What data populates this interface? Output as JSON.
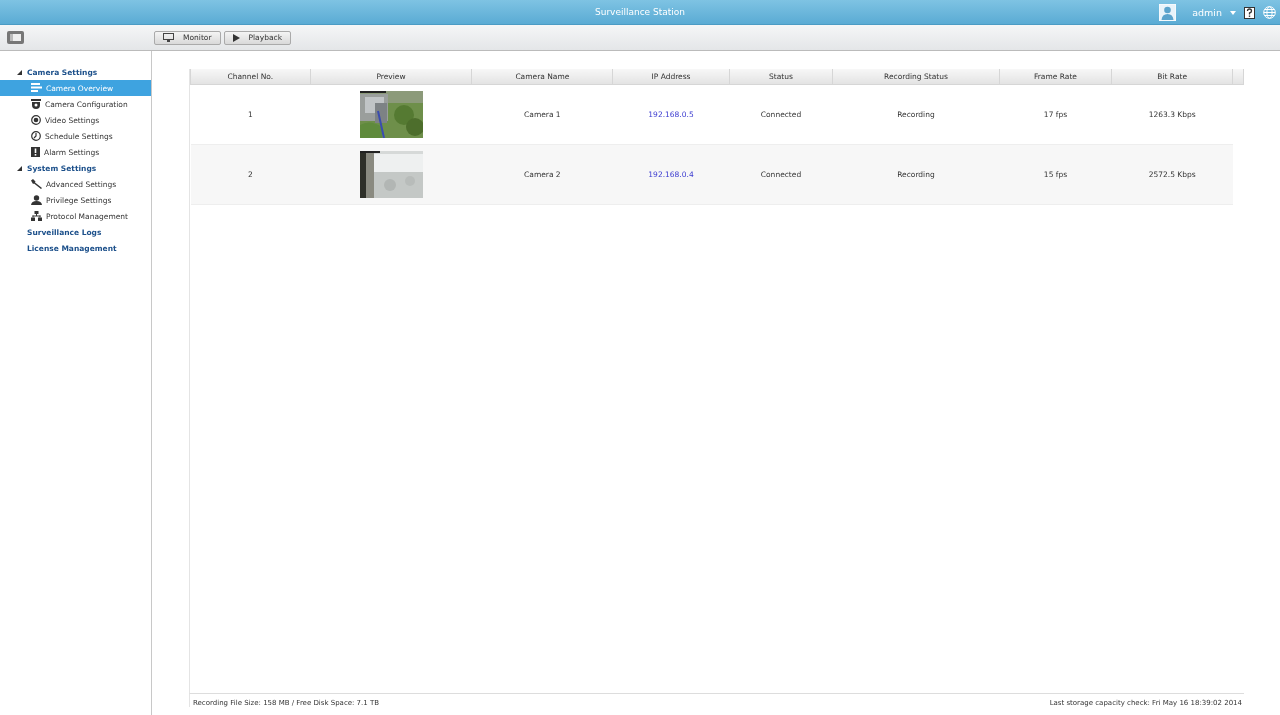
{
  "window": {
    "title": "Surveillance Station"
  },
  "user": {
    "name": "admin"
  },
  "toolbar": {
    "buttons": [
      {
        "label": "Monitor"
      },
      {
        "label": "Playback"
      }
    ]
  },
  "sidebar": {
    "items": [
      {
        "label": "Camera Settings",
        "expanded": true,
        "children": [
          {
            "label": "Camera Overview",
            "selected": true
          },
          {
            "label": "Camera Configuration",
            "selected": false
          },
          {
            "label": "Video Settings",
            "selected": false
          },
          {
            "label": "Schedule Settings",
            "selected": false
          },
          {
            "label": "Alarm Settings",
            "selected": false
          }
        ]
      },
      {
        "label": "System Settings",
        "expanded": true,
        "children": [
          {
            "label": "Advanced Settings",
            "selected": false
          },
          {
            "label": "Privilege Settings",
            "selected": false
          },
          {
            "label": "Protocol Management",
            "selected": false
          }
        ]
      },
      {
        "label": "Surveillance Logs"
      },
      {
        "label": "License Management"
      }
    ]
  },
  "table": {
    "columns": [
      "Channel No.",
      "Preview",
      "Camera Name",
      "IP Address",
      "Status",
      "Recording Status",
      "Frame Rate",
      "Bit Rate"
    ],
    "rows": [
      {
        "channel": "1",
        "name": "Camera 1",
        "ip": "192.168.0.5",
        "status": "Connected",
        "recording": "Recording",
        "frame_rate": "17 fps",
        "bit_rate": "1263.3 Kbps"
      },
      {
        "channel": "2",
        "name": "Camera 2",
        "ip": "192.168.0.4",
        "status": "Connected",
        "recording": "Recording",
        "frame_rate": "15 fps",
        "bit_rate": "2572.5 Kbps"
      }
    ]
  },
  "status_bar": {
    "left": "Recording File Size: 158 MB / Free Disk Space: 7.1 TB",
    "right": "Last storage capacity check: Fri May 16 18:39:02 2014"
  }
}
